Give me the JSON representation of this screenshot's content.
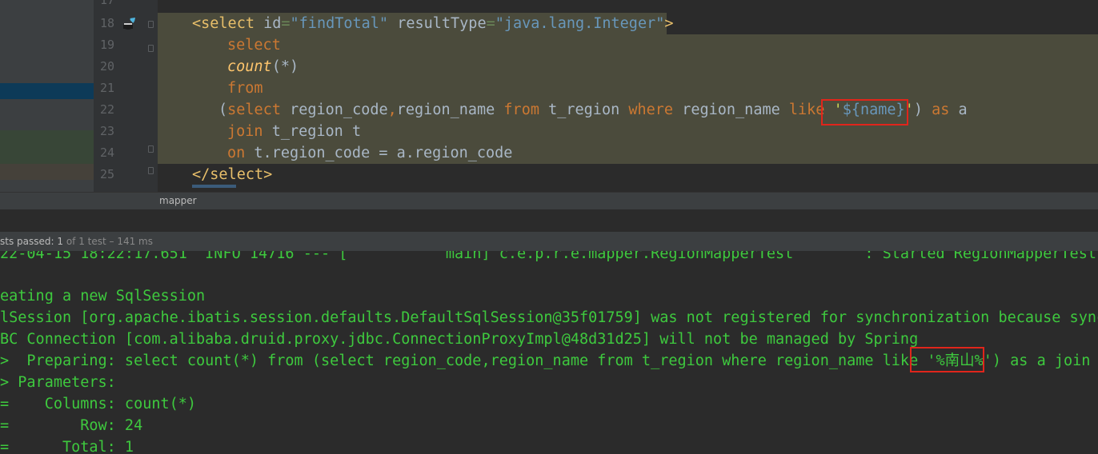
{
  "editor": {
    "line_numbers": [
      "17",
      "18",
      "19",
      "20",
      "21",
      "22",
      "23",
      "24",
      "25"
    ],
    "lines": {
      "l18": {
        "open_bracket": "<",
        "tag": "select",
        "sp1": " ",
        "attr1": "id",
        "eq1": "=",
        "val1": "\"findTotal\"",
        "sp2": " ",
        "attr2": "resultType",
        "eq2": "=",
        "val2": "\"java.lang.Integer\"",
        "close": ">"
      },
      "l19": {
        "kw": "select"
      },
      "l20": {
        "fn": "count",
        "args": "(*)"
      },
      "l21": {
        "kw": "from"
      },
      "l22": {
        "paren": "(",
        "kw1": "select",
        "cols1": " region_code",
        "comma": ",",
        "cols2": "region_name ",
        "kw2": "from",
        "tbl": " t_region ",
        "kw3": "where",
        "col": " region_name ",
        "kw4": "like",
        "sp": " ",
        "q1": "'",
        "param": "${name}",
        "q2": "'",
        "close": ")",
        "sp2": " ",
        "kw5": "as",
        "alias": " a"
      },
      "l23": {
        "kw": "join",
        "rest": " t_region t"
      },
      "l24": {
        "kw": "on",
        "rest": " t.region_code = a.region_code"
      },
      "l25": {
        "open": "</",
        "tag": "select",
        "close": ">"
      }
    }
  },
  "breadcrumb": {
    "label": "mapper"
  },
  "test_status": {
    "passed_label": "sts passed: ",
    "count": "1",
    "detail": " of 1 test – 141 ms"
  },
  "console": {
    "lines": [
      "22-04-15 18:22:17.651  INFO 14716 --- [           main] c.e.p.r.e.mapper.RegionMapperTest        : Started RegionMapperTest i",
      "",
      "eating a new SqlSession",
      "lSession [org.apache.ibatis.session.defaults.DefaultSqlSession@35f01759] was not registered for synchronization because synch",
      "BC Connection [com.alibaba.druid.proxy.jdbc.ConnectionProxyImpl@48d31d25] will not be managed by Spring",
      ">  Preparing: select count(*) from (select region_code,region_name from t_region where region_name like '%南山%') as a join t_",
      "> Parameters: ",
      "=    Columns: count(*)",
      "=        Row: 24",
      "=      Total: 1"
    ]
  },
  "colors": {
    "keyword": "#cc7832",
    "tag": "#e8bf6a",
    "string": "#6a8759",
    "console_text": "#3ec93e",
    "highlight_box": "#e0251b"
  }
}
